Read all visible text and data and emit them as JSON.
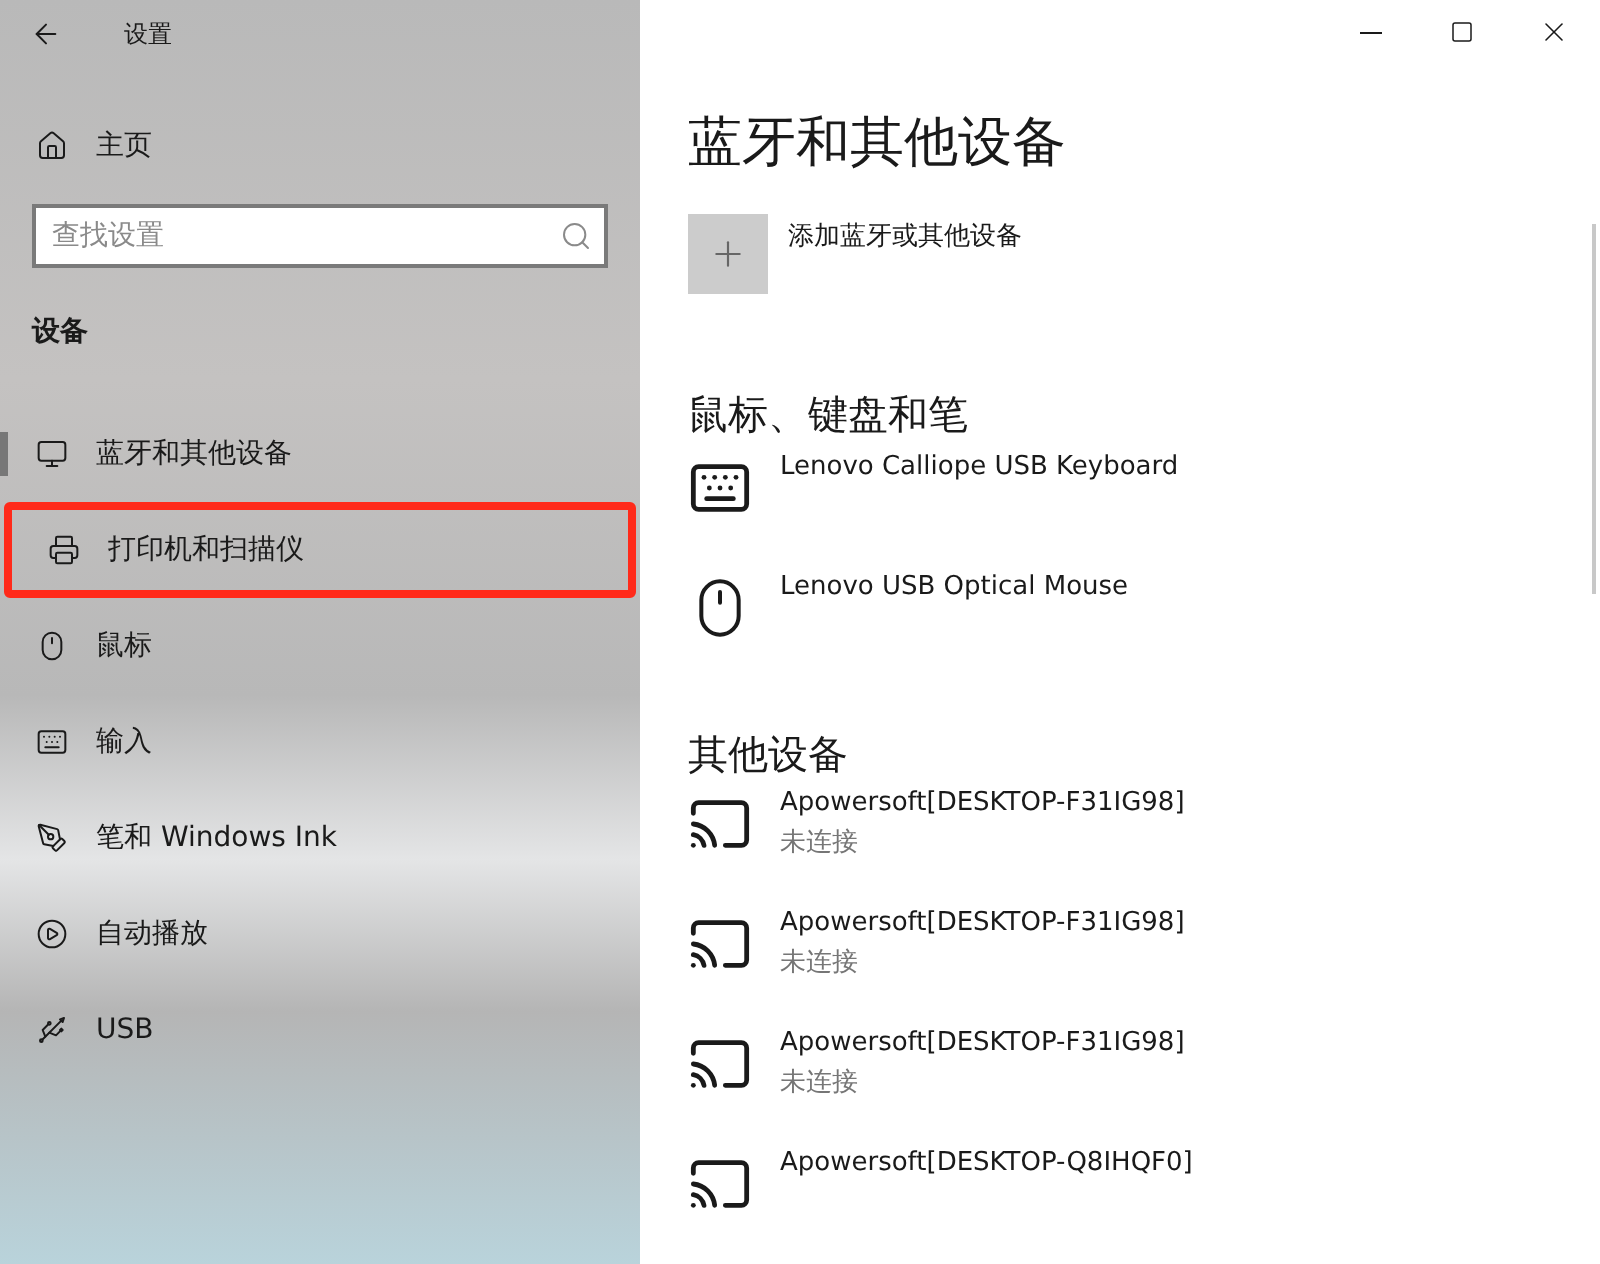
{
  "window": {
    "title": "设置"
  },
  "sidebar": {
    "home": "主页",
    "search": {
      "placeholder": "查找设置"
    },
    "section": "设备",
    "items": [
      {
        "kind": "bluetooth",
        "label": "蓝牙和其他设备",
        "selected": true,
        "highlighted": false
      },
      {
        "kind": "printer",
        "label": "打印机和扫描仪",
        "selected": false,
        "highlighted": true
      },
      {
        "kind": "mouse",
        "label": "鼠标",
        "selected": false,
        "highlighted": false
      },
      {
        "kind": "keyboard",
        "label": "输入",
        "selected": false,
        "highlighted": false
      },
      {
        "kind": "pen",
        "label": "笔和 Windows Ink",
        "selected": false,
        "highlighted": false
      },
      {
        "kind": "autoplay",
        "label": "自动播放",
        "selected": false,
        "highlighted": false
      },
      {
        "kind": "usb",
        "label": "USB",
        "selected": false,
        "highlighted": false
      }
    ]
  },
  "main": {
    "title": "蓝牙和其他设备",
    "add_button": "添加蓝牙或其他设备",
    "sections": [
      {
        "heading": "鼠标、键盘和笔",
        "devices": [
          {
            "kind": "keyboard",
            "name": "Lenovo Calliope USB Keyboard"
          },
          {
            "kind": "mouse",
            "name": "Lenovo USB Optical Mouse"
          }
        ]
      },
      {
        "heading": "其他设备",
        "devices": [
          {
            "kind": "display",
            "name": "Apowersoft[DESKTOP-F31IG98]",
            "status": "未连接"
          },
          {
            "kind": "display",
            "name": "Apowersoft[DESKTOP-F31IG98]",
            "status": "未连接"
          },
          {
            "kind": "display",
            "name": "Apowersoft[DESKTOP-F31IG98]",
            "status": "未连接"
          },
          {
            "kind": "display",
            "name": "Apowersoft[DESKTOP-Q8IHQF0]"
          }
        ]
      }
    ]
  }
}
